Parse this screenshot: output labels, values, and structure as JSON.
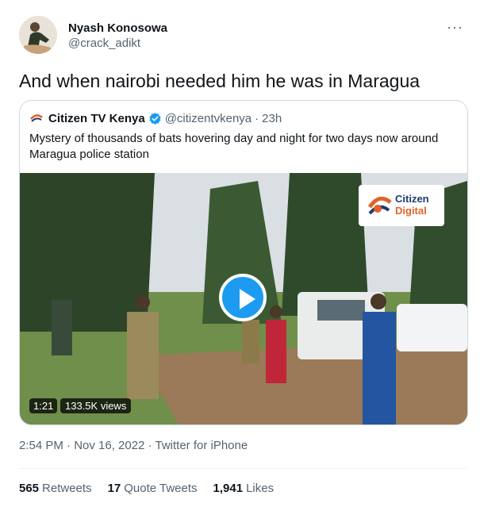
{
  "tweet": {
    "author_name": "Nyash Konosowa",
    "author_handle": "@crack_adikt",
    "more_label": "···",
    "text": "And when nairobi needed him he was in Maragua",
    "timestamp": "2:54 PM · Nov 16, 2022 · Twitter for iPhone",
    "stats": [
      {
        "count": "565",
        "label": "Retweets"
      },
      {
        "count": "17",
        "label": "Quote Tweets"
      },
      {
        "count": "1,941",
        "label": "Likes"
      }
    ]
  },
  "quoted": {
    "author_name": "Citizen TV Kenya",
    "author_handle": "@citizentvkenya",
    "separator": "·",
    "time": "23h",
    "text": "Mystery of thousands of bats hovering day and night for two days now around Maragua police station",
    "video": {
      "duration": "1:21",
      "views": "133.5K views",
      "logo_line1": "Citizen",
      "logo_line2": "Digital"
    }
  },
  "colors": {
    "accent": "#1d9bf0",
    "secondary_text": "#536471",
    "border": "#cfd9de"
  }
}
